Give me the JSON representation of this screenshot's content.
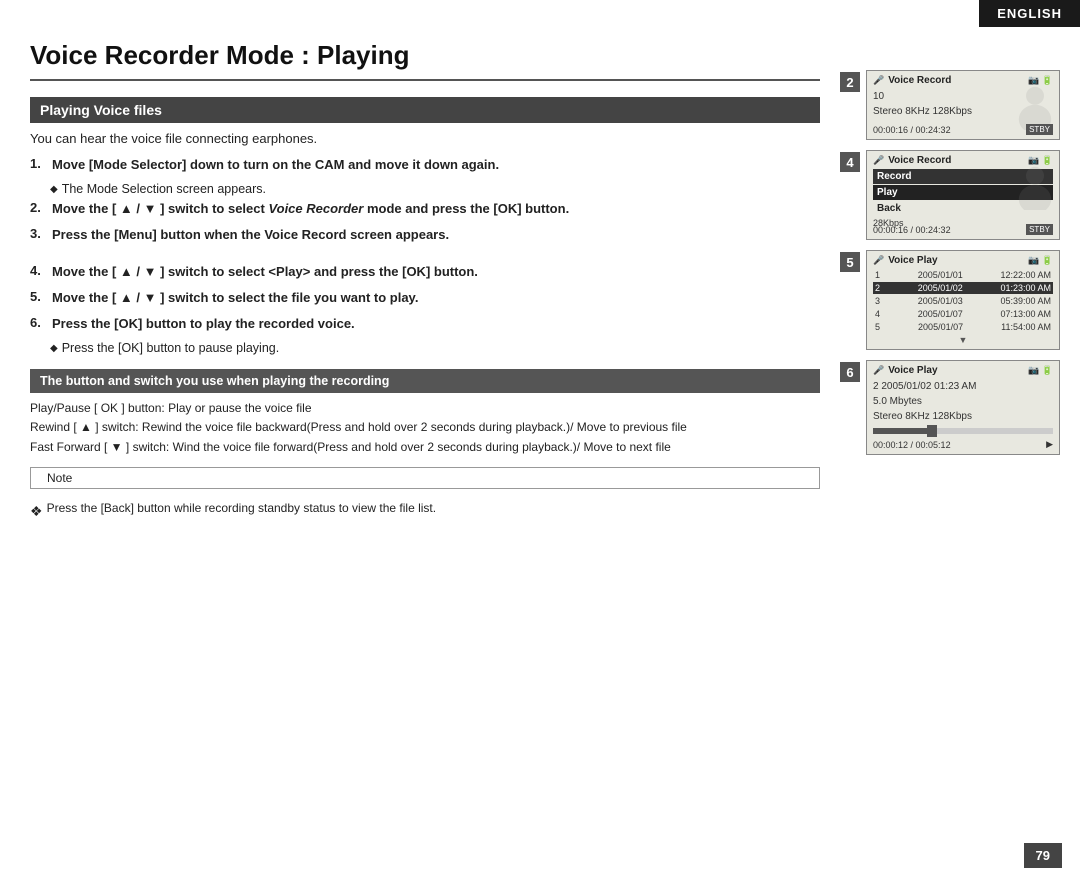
{
  "badge": {
    "label": "ENGLISH"
  },
  "page": {
    "title": "Voice Recorder Mode : Playing"
  },
  "section": {
    "header": "Playing Voice files",
    "intro": "You can hear the voice file connecting earphones."
  },
  "steps": [
    {
      "num": "1.",
      "text": "Move [Mode Selector] down to turn on the CAM and move it down again.",
      "subnote": "The Mode Selection screen appears."
    },
    {
      "num": "2.",
      "text_plain": "Move the [ ▲ / ▼ ] switch to select ",
      "text_italic": "Voice Recorder",
      "text_end": " mode and press the [OK] button.",
      "subnote": null
    },
    {
      "num": "3.",
      "text": "Press the [Menu] button when the Voice Record screen appears.",
      "subnote": null
    },
    {
      "num": "4.",
      "text": "Move the [ ▲ / ▼ ] switch to select <Play> and press the [OK] button.",
      "subnote": null
    },
    {
      "num": "5.",
      "text": "Move the [ ▲ / ▼ ] switch to select the file you want to play.",
      "subnote": null
    },
    {
      "num": "6.",
      "text": "Press the [OK] button to play the recorded voice.",
      "subnote": "Press the [OK] button to pause playing."
    }
  ],
  "tip_box": {
    "header": "The button and switch you use when playing the recording",
    "lines": [
      "Play/Pause [ OK ] button: Play or pause the voice file",
      "Rewind [ ▲ ] switch: Rewind the voice file backward(Press and hold over 2 seconds during playback.)/ Move to previous file",
      "Fast Forward [ ▼ ] switch: Wind the voice file forward(Press and hold over 2 seconds during playback.)/ Move to next file"
    ]
  },
  "note_label": "Note",
  "footer_note": "Press the [Back] button while recording standby status to view the file list.",
  "page_number": "79",
  "screens": [
    {
      "num": "2",
      "title": "Voice Record",
      "body_line1": "10",
      "body_line2": "Stereo 8KHz 128Kbps",
      "footer_time": "00:00:16 / 00:24:32",
      "footer_status": "STBY",
      "type": "record_standby"
    },
    {
      "num": "4",
      "title": "Voice Record",
      "menu": [
        "Record",
        "Play",
        "Back"
      ],
      "selected": "Record",
      "body_kbps": "28Kbps",
      "footer_time": "00:00:16 / 00:24:32",
      "footer_status": "STBY",
      "type": "menu"
    },
    {
      "num": "5",
      "title": "Voice Play",
      "files": [
        {
          "idx": "1",
          "date": "2005/01/01",
          "time": "12:22:00 AM"
        },
        {
          "idx": "2",
          "date": "2005/01/02",
          "time": "01:23:00 AM",
          "highlighted": true
        },
        {
          "idx": "3",
          "date": "2005/01/03",
          "time": "05:39:00 AM"
        },
        {
          "idx": "4",
          "date": "2005/01/07",
          "time": "07:13:00 AM"
        },
        {
          "idx": "5",
          "date": "2005/01/07",
          "time": "11:54:00 AM"
        }
      ],
      "type": "file_list"
    },
    {
      "num": "6",
      "title": "Voice Play",
      "body_date": "2 2005/01/02  01:23 AM",
      "body_size": "5.0 Mbytes",
      "body_audio": "Stereo 8KHz 128Kbps",
      "footer_time": "00:00:12 / 00:05:12",
      "footer_play": "▶",
      "progress": 30,
      "type": "playing"
    }
  ]
}
